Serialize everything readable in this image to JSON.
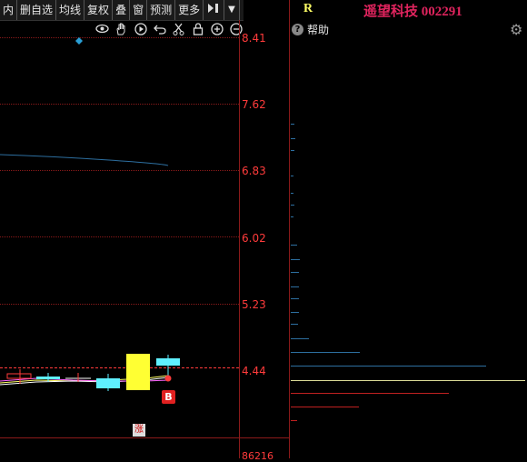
{
  "toolbar": {
    "items": [
      "内",
      "删自选",
      "均线",
      "复权",
      "叠",
      "窗",
      "预测",
      "更多"
    ],
    "play_icon": "next-page-icon",
    "dropdown_icon": "chevron-down-icon"
  },
  "chart": {
    "price_labels": [
      "8.41",
      "7.62",
      "6.83",
      "6.02",
      "5.23",
      "4.44"
    ],
    "bottom_label": "86216",
    "buy_marker": "B",
    "limit_marker": "涨",
    "tools": [
      "eye-icon",
      "hand-icon",
      "play-circle-icon",
      "undo-icon",
      "scissors-icon",
      "lock-icon",
      "zoom-in-icon",
      "zoom-out-icon"
    ],
    "colors": {
      "up": "#ff3b3b",
      "cyan": "#5ff0ff",
      "yellow": "#ffff33",
      "grid": "#8b1a1a"
    }
  },
  "side": {
    "letter": "R",
    "title": "遥望科技 002291",
    "help_label": "帮助",
    "help_icon": "question-icon",
    "settings_icon": "gear-icon"
  }
}
